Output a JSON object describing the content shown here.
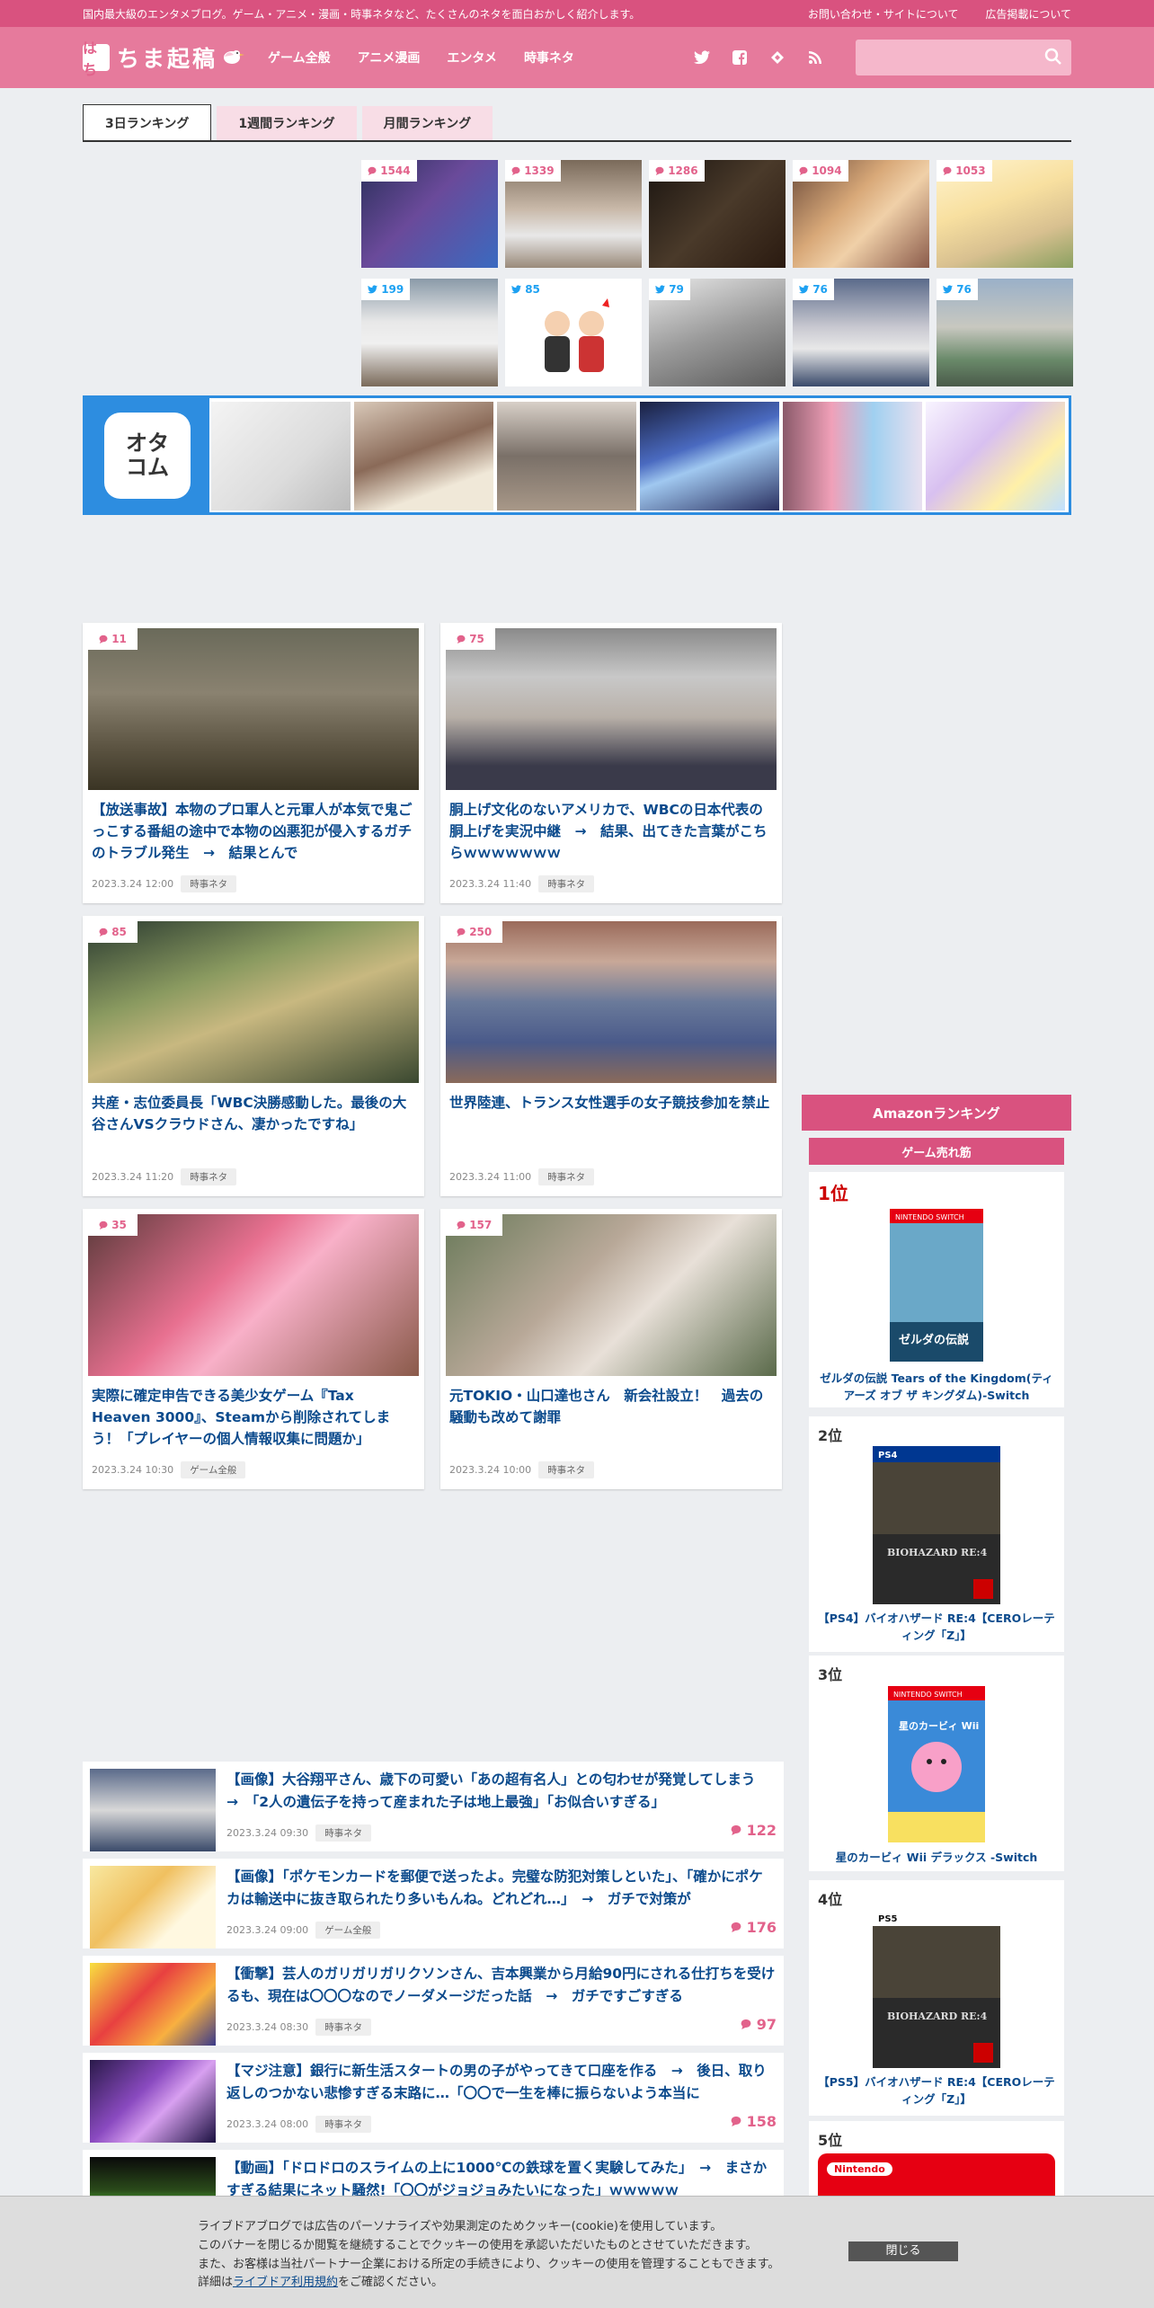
{
  "topbar": {
    "tagline": "国内最大級のエンタメブログ。ゲーム・アニメ・漫画・時事ネタなど、たくさんのネタを面白おかしく紹介します。",
    "links": [
      "お問い合わせ・サイトについて",
      "広告掲載について"
    ]
  },
  "header": {
    "logo_mark": "はち",
    "logo_text": "ちま起稿",
    "nav": [
      "ゲーム全般",
      "アニメ漫画",
      "エンタメ",
      "時事ネタ"
    ],
    "search_placeholder": ""
  },
  "ranking": {
    "tabs": [
      "3日ランキング",
      "1週間ランキング",
      "月間ランキング"
    ],
    "comment_counts": [
      "1544",
      "1339",
      "1286",
      "1094",
      "1053"
    ],
    "tweet_counts": [
      "199",
      "85",
      "79",
      "76",
      "76"
    ]
  },
  "otacom": {
    "logo_line1": "オタ",
    "logo_line2": "コム"
  },
  "cards": [
    {
      "count": "11",
      "title": "【放送事故】本物のプロ軍人と元軍人が本気で鬼ごっこする番組の途中で本物の凶悪犯が侵入するガチのトラブル発生　→　結果とんで",
      "date": "2023.3.24 12:00",
      "tag": "時事ネタ"
    },
    {
      "count": "75",
      "title": "胴上げ文化のないアメリカで、WBCの日本代表の胴上げを実況中継　→　結果、出てきた言葉がこちらｗｗｗｗｗｗｗ",
      "date": "2023.3.24 11:40",
      "tag": "時事ネタ"
    },
    {
      "count": "85",
      "title": "共産・志位委員長「WBC決勝感動した。最後の大谷さんVSクラウドさん、凄かったですね」",
      "date": "2023.3.24 11:20",
      "tag": "時事ネタ"
    },
    {
      "count": "250",
      "title": "世界陸連、トランス女性選手の女子競技参加を禁止",
      "date": "2023.3.24 11:00",
      "tag": "時事ネタ"
    },
    {
      "count": "35",
      "title": "実際に確定申告できる美少女ゲーム『Tax Heaven 3000』、Steamから削除されてしまう！「プレイヤーの個人情報収集に問題か」",
      "date": "2023.3.24 10:30",
      "tag": "ゲーム全般"
    },
    {
      "count": "157",
      "title": "元TOKIO・山口達也さん　新会社設立！　過去の騒動も改めて謝罪",
      "date": "2023.3.24 10:00",
      "tag": "時事ネタ"
    }
  ],
  "list": [
    {
      "title": "【画像】大谷翔平さん、歳下の可愛い「あの超有名人」との匂わせが発覚してしまう　→　「2人の遺伝子を持って産まれた子は地上最強」「お似合いすぎる」",
      "date": "2023.3.24 09:30",
      "tag": "時事ネタ",
      "count": "122"
    },
    {
      "title": "【画像】「ポケモンカードを郵便で送ったよ。完璧な防犯対策しといた」、「確かにポケカは輸送中に抜き取られたり多いもんね。どれどれ…」　→　ガチで対策が",
      "date": "2023.3.24 09:00",
      "tag": "ゲーム全般",
      "count": "176"
    },
    {
      "title": "【衝撃】芸人のガリガリガリクソンさん、吉本興業から月給90円にされる仕打ちを受けるも、現在は〇〇〇なのでノーダメージだった話　→　ガチですごすぎる",
      "date": "2023.3.24 08:30",
      "tag": "時事ネタ",
      "count": "97"
    },
    {
      "title": "【マジ注意】銀行に新生活スタートの男の子がやってきて口座を作る　→　後日、取り返しのつかない悲惨すぎる末路に…「〇〇で一生を棒に振らないよう本当に",
      "date": "2023.3.24 08:00",
      "tag": "時事ネタ",
      "count": "158"
    },
    {
      "title": "【動画】「ドロドロのスライムの上に1000℃の鉄球を置く実験してみた」　→　まさかすぎる結果にネット騒然!「〇〇がジョジョみたいになった」ｗｗｗｗｗ",
      "date": "",
      "tag": "",
      "count": ""
    }
  ],
  "sidebar": {
    "heading": "Amazonランキング",
    "subheading": "ゲーム売れ筋",
    "products": [
      {
        "rank": "1位",
        "name": "ゼルダの伝説 Tears of the Kingdom(ティアーズ オブ ザ キングダム)-Switch",
        "cover_text": "ゼルダの伝説",
        "platform": "NINTENDO SWITCH"
      },
      {
        "rank": "2位",
        "name": "【PS4】バイオハザード RE:4【CEROレーティング「Z」】",
        "cover_text": "BIOHAZARD RE:4",
        "platform": "PS4"
      },
      {
        "rank": "3位",
        "name": "星のカービィ Wii デラックス -Switch",
        "cover_text": "星のカービィ Wii",
        "platform": "NINTENDO SWITCH"
      },
      {
        "rank": "4位",
        "name": "【PS5】バイオハザード RE:4【CEROレーティング「Z」】",
        "cover_text": "BIOHAZARD RE:4",
        "platform": "PS5"
      },
      {
        "rank": "5位",
        "name": "",
        "cover_text": "Nintendo",
        "platform": ""
      }
    ]
  },
  "cookie": {
    "line1": "ライブドアブログでは広告のパーソナライズや効果測定のためクッキー(cookie)を使用しています。",
    "line2": "このバナーを閉じるか閲覧を継続することでクッキーの使用を承認いただいたものとさせていただきます。",
    "line3": "また、お客様は当社パートナー企業における所定の手続きにより、クッキーの使用を管理することもできます。",
    "line4_pre": "詳細は",
    "line4_link": "ライブドア利用規約",
    "line4_post": "をご確認ください。",
    "close_label": "閉じる"
  },
  "colors": {
    "accent": "#d9527f",
    "header": "#e67a9c",
    "link": "#0b4a8c",
    "otacom_blue": "#2d8de0"
  }
}
